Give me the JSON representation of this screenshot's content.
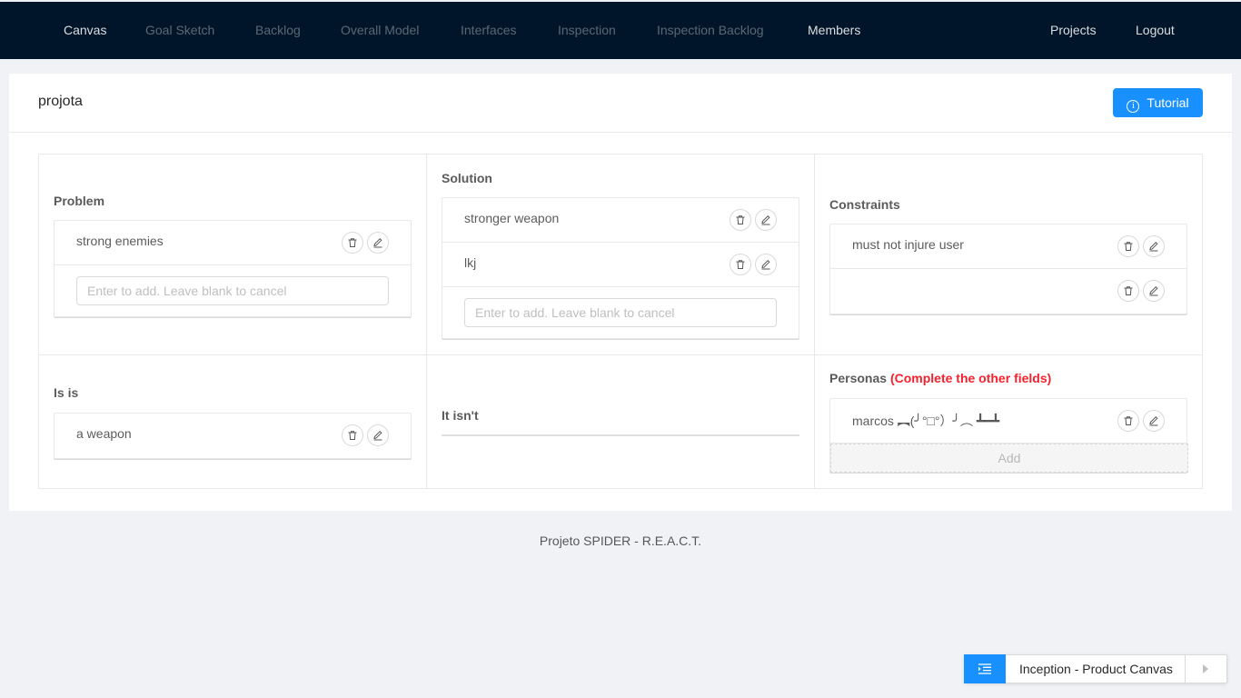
{
  "nav": {
    "items": [
      {
        "label": "Canvas"
      },
      {
        "label": "Goal Sketch"
      },
      {
        "label": "Backlog"
      },
      {
        "label": "Overall Model"
      },
      {
        "label": "Interfaces"
      },
      {
        "label": "Inspection"
      },
      {
        "label": "Inspection Backlog"
      },
      {
        "label": "Members"
      }
    ],
    "projects": "Projects",
    "logout": "Logout"
  },
  "header": {
    "project_name": "projota",
    "tutorial_label": "Tutorial"
  },
  "canvas": {
    "problem": {
      "title": "Problem",
      "items": [
        "strong enemies"
      ],
      "placeholder": "Enter to add. Leave blank to cancel"
    },
    "solution": {
      "title": "Solution",
      "items": [
        "stronger weapon",
        "lkj"
      ],
      "placeholder": "Enter to add. Leave blank to cancel"
    },
    "constraints": {
      "title": "Constraints",
      "items": [
        "must not injure user",
        ""
      ]
    },
    "is_is": {
      "title": "Is is",
      "items": [
        "a weapon"
      ]
    },
    "it_isnt": {
      "title": "It isn't"
    },
    "personas": {
      "title": "Personas",
      "warning": "(Complete the other fields)",
      "items": [
        "marcos ︻(╯°□°）╯︵ ┻━┻"
      ],
      "add_label": "Add"
    }
  },
  "footer": {
    "text": "Projeto SPIDER - R.E.A.C.T."
  },
  "step_widget": {
    "label": "Inception - Product Canvas"
  },
  "colors": {
    "nav_bg": "#001529",
    "primary": "#1890ff",
    "warning": "#f5222d"
  }
}
